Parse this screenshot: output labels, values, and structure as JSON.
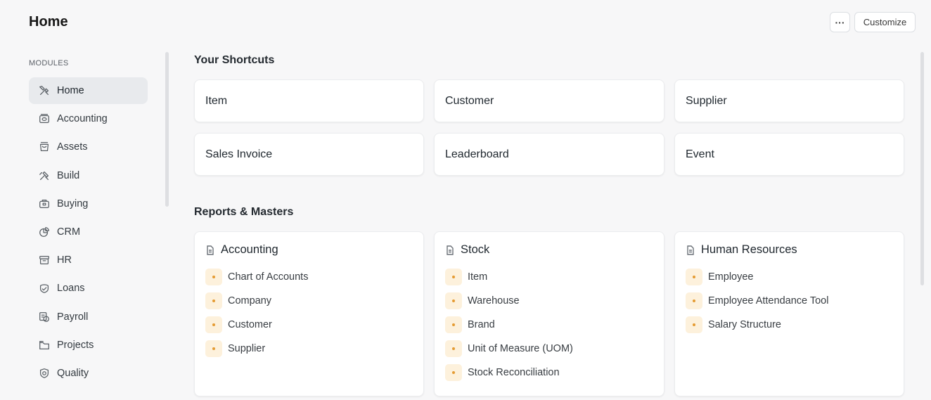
{
  "page": {
    "title": "Home"
  },
  "header": {
    "more_label": "···",
    "customize_label": "Customize"
  },
  "sidebar": {
    "heading": "MODULES",
    "items": [
      {
        "label": "Home",
        "icon": "home-tools-icon",
        "active": true
      },
      {
        "label": "Accounting",
        "icon": "accounting-icon"
      },
      {
        "label": "Assets",
        "icon": "assets-icon"
      },
      {
        "label": "Build",
        "icon": "build-icon"
      },
      {
        "label": "Buying",
        "icon": "buying-icon"
      },
      {
        "label": "CRM",
        "icon": "crm-icon"
      },
      {
        "label": "HR",
        "icon": "hr-icon"
      },
      {
        "label": "Loans",
        "icon": "loans-icon"
      },
      {
        "label": "Payroll",
        "icon": "payroll-icon"
      },
      {
        "label": "Projects",
        "icon": "projects-icon"
      },
      {
        "label": "Quality",
        "icon": "quality-icon"
      }
    ]
  },
  "shortcuts": {
    "title": "Your Shortcuts",
    "items": [
      "Item",
      "Customer",
      "Supplier",
      "Sales Invoice",
      "Leaderboard",
      "Event"
    ]
  },
  "reports": {
    "title": "Reports & Masters",
    "cards": [
      {
        "title": "Accounting",
        "links": [
          "Chart of Accounts",
          "Company",
          "Customer",
          "Supplier"
        ]
      },
      {
        "title": "Stock",
        "links": [
          "Item",
          "Warehouse",
          "Brand",
          "Unit of Measure (UOM)",
          "Stock Reconciliation"
        ]
      },
      {
        "title": "Human Resources",
        "links": [
          "Employee",
          "Employee Attendance Tool",
          "Salary Structure"
        ]
      }
    ]
  },
  "colors": {
    "accent_dot": "#e59b33",
    "dot_bg": "#fdf1dc",
    "active_bg": "#e8eaed"
  }
}
